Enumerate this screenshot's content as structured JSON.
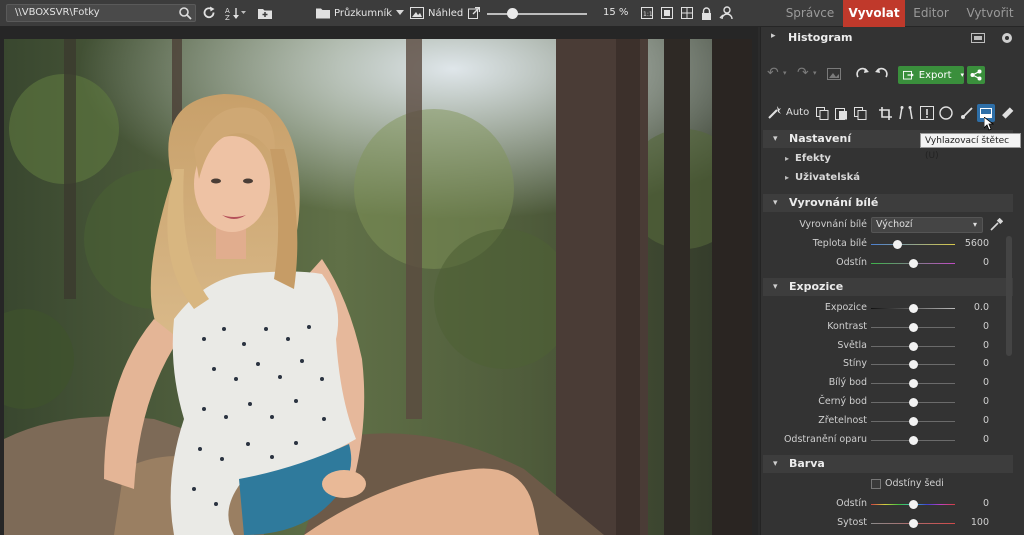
{
  "topbar": {
    "path": "\\\\VBOXSVR\\Fotky",
    "browser_label": "Průzkumník",
    "preview_label": "Náhled",
    "zoom": "15 %",
    "zoom_fraction": 0.15
  },
  "modes": [
    {
      "label": "Správce",
      "active": false
    },
    {
      "label": "Vyvolat",
      "active": true
    },
    {
      "label": "Editor",
      "active": false
    },
    {
      "label": "Vytvořit",
      "active": false
    }
  ],
  "panel": {
    "histogram_label": "Histogram",
    "export_label": "Export",
    "auto_label": "Auto",
    "tooltip": "Vyhlazovací štětec (U)",
    "nastaveni": {
      "title": "Nastavení",
      "items": [
        "Efekty",
        "Uživatelská"
      ]
    },
    "white_balance": {
      "title": "Vyrovnání bílé",
      "wb_label": "Vyrovnání bílé",
      "wb_value": "Výchozí",
      "rows": [
        {
          "label": "Teplota bílé",
          "value": "5600",
          "knob": 0.32
        },
        {
          "label": "Odstín",
          "value": "0",
          "knob": 0.5
        }
      ]
    },
    "exposure": {
      "title": "Expozice",
      "rows": [
        {
          "label": "Expozice",
          "value": "0.0",
          "knob": 0.5
        },
        {
          "label": "Kontrast",
          "value": "0",
          "knob": 0.5
        },
        {
          "label": "Světla",
          "value": "0",
          "knob": 0.5
        },
        {
          "label": "Stíny",
          "value": "0",
          "knob": 0.5
        },
        {
          "label": "Bílý bod",
          "value": "0",
          "knob": 0.5
        },
        {
          "label": "Černý bod",
          "value": "0",
          "knob": 0.5
        },
        {
          "label": "Zřetelnost",
          "value": "0",
          "knob": 0.5
        },
        {
          "label": "Odstranění oparu",
          "value": "0",
          "knob": 0.5
        }
      ]
    },
    "color": {
      "title": "Barva",
      "grayscale_label": "Odstíny šedi",
      "rows": [
        {
          "label": "Odstín",
          "value": "0",
          "knob": 0.5
        },
        {
          "label": "Sytost",
          "value": "100",
          "knob": 0.5
        }
      ]
    }
  },
  "colors": {
    "accent": "#c0392b",
    "export_green": "#3a8f3c"
  }
}
